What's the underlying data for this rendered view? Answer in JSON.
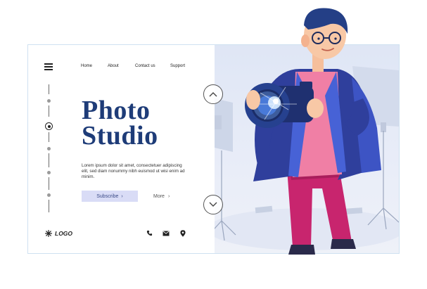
{
  "nav": {
    "items": [
      {
        "label": "Home"
      },
      {
        "label": "About"
      },
      {
        "label": "Contact us"
      },
      {
        "label": "Support"
      }
    ]
  },
  "hero": {
    "title_line1": "Photo",
    "title_line2": "Studio",
    "body": "Lorem ipsum dolor sit amet, consectetuer adipiscing elit, sed diam nonummy nibh euismod ut wisi enim ad minim.",
    "subscribe_label": "Subscribe",
    "more_label": "More"
  },
  "footer": {
    "logo_text": "LOGO"
  },
  "icons": {
    "menu": "hamburger-menu-icon",
    "up": "chevron-up-icon",
    "down": "chevron-down-icon",
    "phone": "phone-icon",
    "mail": "mail-icon",
    "location": "location-pin-icon",
    "logo": "snowflake-logo-icon"
  },
  "colors": {
    "title": "#1e3c78",
    "button_bg": "#d9dcf6",
    "card_border": "#cfe1f1",
    "jacket": "#2f3f9c",
    "shirt": "#f07fa5",
    "pants": "#c8256e"
  }
}
